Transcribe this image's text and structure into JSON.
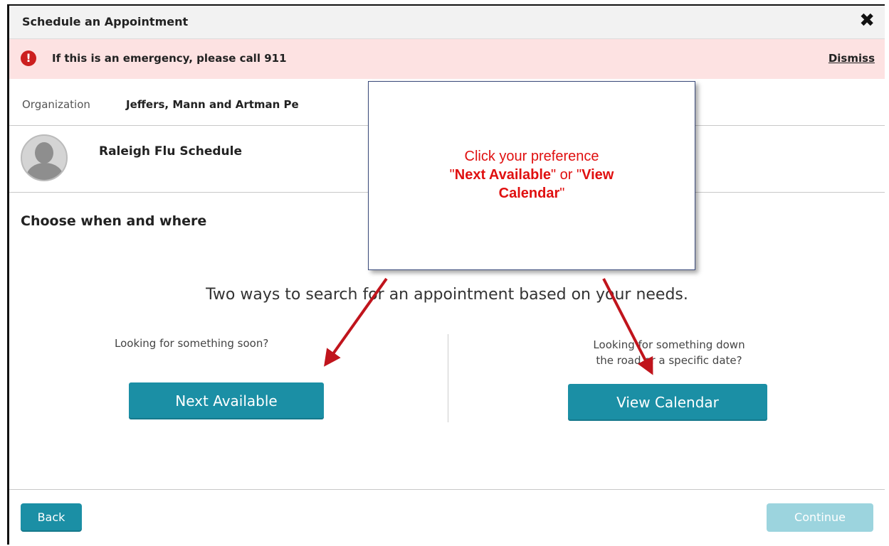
{
  "dialog": {
    "title": "Schedule an Appointment",
    "close_symbol": "✖"
  },
  "alert": {
    "icon": "alert-circle-icon",
    "message": "If this is an emergency, please call 911",
    "dismiss_label": "Dismiss"
  },
  "organization": {
    "label": "Organization",
    "name": "Jeffers, Mann and Artman Pe"
  },
  "schedule": {
    "avatar_icon": "user-avatar-icon",
    "name": "Raleigh Flu Schedule"
  },
  "main": {
    "section_title": "Choose when and where",
    "intro": "Two ways to search for an appointment based on your needs.",
    "left": {
      "prompt": "Looking for something soon?",
      "button": "Next Available"
    },
    "right": {
      "prompt_line1": "Looking for something down",
      "prompt_line2": "the road or a specific date?",
      "button": "View Calendar"
    }
  },
  "footer": {
    "back_label": "Back",
    "continue_label": "Continue"
  },
  "callout": {
    "line1": "Click your preference",
    "line2_q1": "\"",
    "line2_b1": "Next Available",
    "line2_mid": "\" or \"",
    "line2_b2": "View",
    "line3_b": "Calendar",
    "line3_q": "\""
  },
  "colors": {
    "accent": "#1b8fa5",
    "alert_bg": "#fde2e2",
    "annotation_red": "#e01010",
    "arrow_red": "#c0141c"
  }
}
